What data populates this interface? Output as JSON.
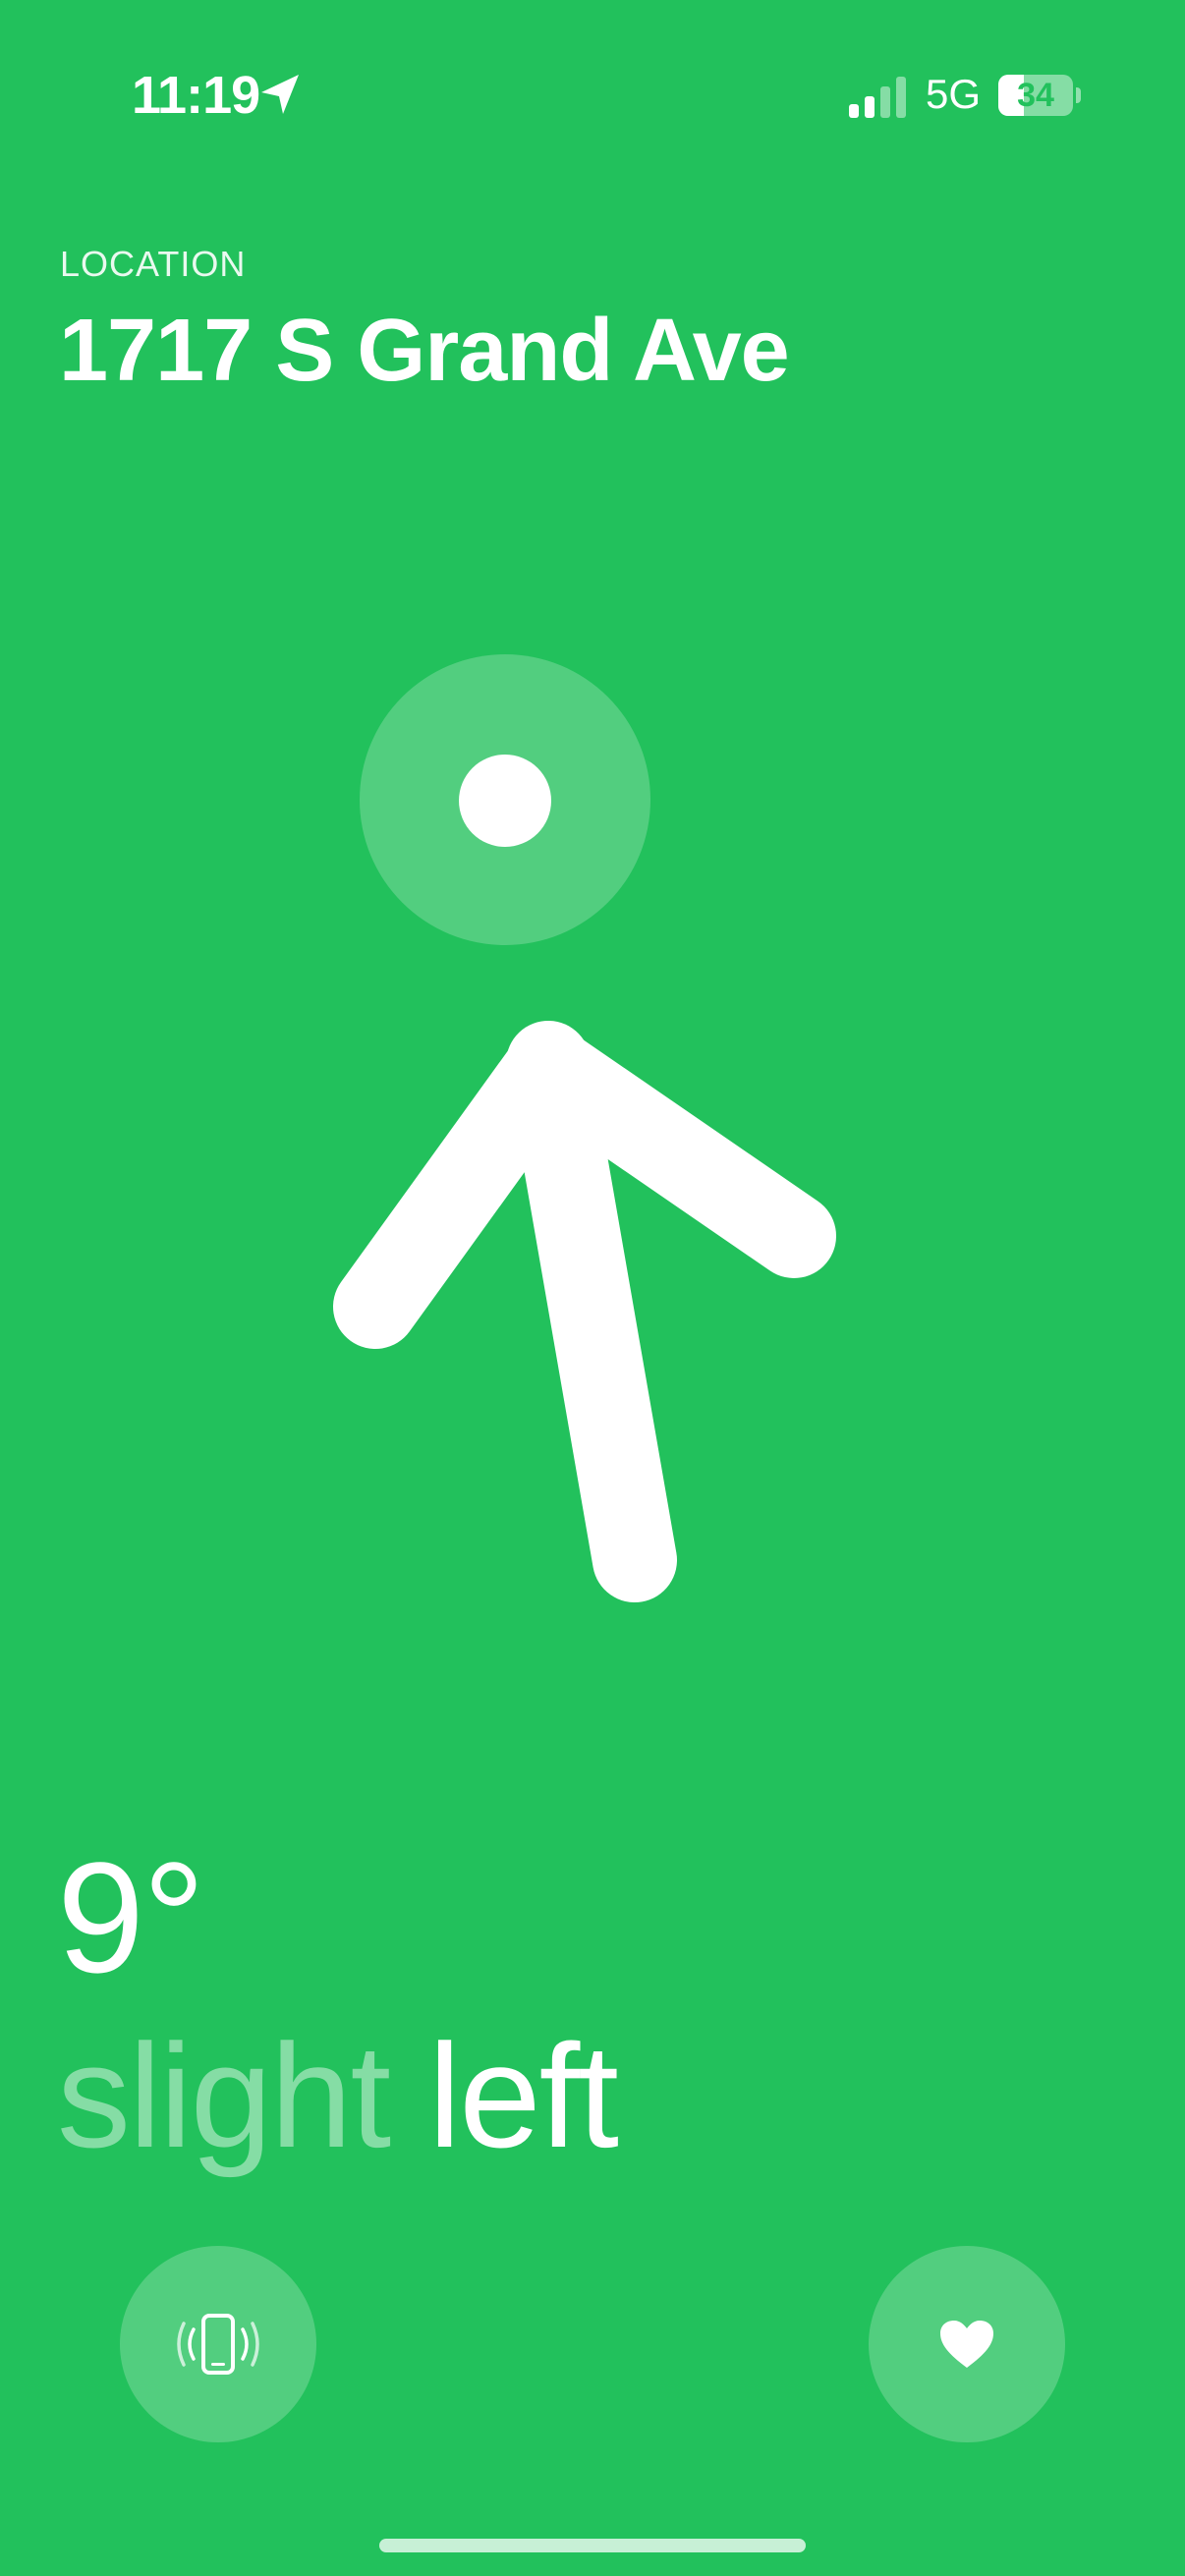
{
  "status_bar": {
    "time": "11:19",
    "location_icon": "location-arrow-icon",
    "signal_icon": "cellular-signal-icon",
    "network": "5G",
    "battery": "34",
    "battery_level_percent": 34
  },
  "header": {
    "label": "LOCATION",
    "title": "1717 S Grand Ave"
  },
  "navigation": {
    "target_icon": "target-circle-icon",
    "direction_icon": "direction-arrow-icon",
    "degrees": "9°",
    "direction_muted": "slight",
    "direction_emphasis": "left"
  },
  "controls": {
    "left_icon": "phone-vibrate-icon",
    "right_icon": "heart-icon"
  },
  "colors": {
    "background": "#22c15c",
    "foreground": "#ffffff"
  }
}
